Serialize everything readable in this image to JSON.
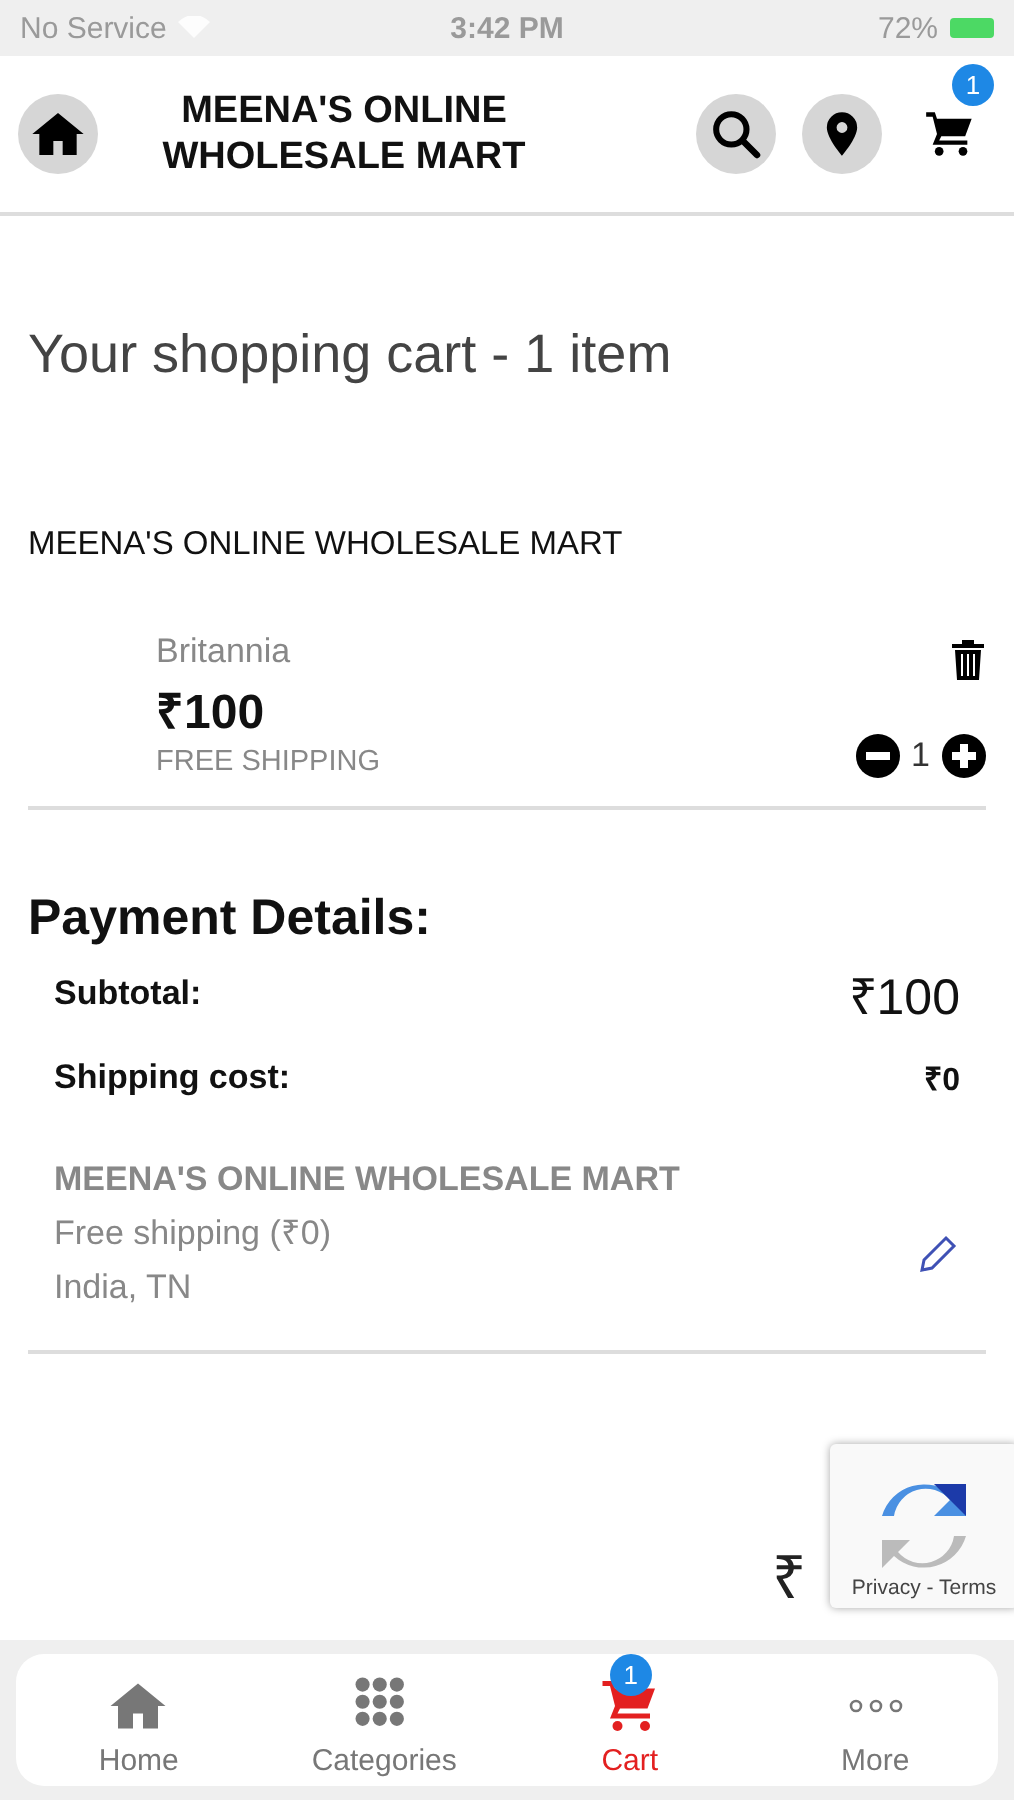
{
  "status_bar": {
    "carrier": "No Service",
    "time": "3:42 PM",
    "battery": "72%"
  },
  "header": {
    "title": "MEENA'S ONLINE WHOLESALE MART",
    "cart_badge": "1"
  },
  "cart": {
    "heading": "Your shopping cart - 1 item",
    "store": "MEENA'S ONLINE WHOLESALE MART",
    "items": [
      {
        "brand": "Britannia",
        "price": "₹100",
        "shipping": "FREE SHIPPING",
        "quantity": "1"
      }
    ]
  },
  "payment": {
    "heading": "Payment Details:",
    "rows": [
      {
        "label": "Subtotal:",
        "value": "₹100",
        "kind": "large"
      },
      {
        "label": "Shipping cost:",
        "value": "₹0",
        "kind": "small"
      }
    ],
    "store": "MEENA'S ONLINE WHOLESALE MART",
    "shipping_method": "Free shipping (₹0)",
    "location": "India, TN",
    "total_partial": "₹"
  },
  "recaptcha": {
    "links": "Privacy - Terms"
  },
  "bottom_nav": [
    {
      "label": "Home",
      "selected": false
    },
    {
      "label": "Categories",
      "selected": false
    },
    {
      "label": "Cart",
      "selected": true,
      "badge": "1"
    },
    {
      "label": "More",
      "selected": false
    }
  ]
}
